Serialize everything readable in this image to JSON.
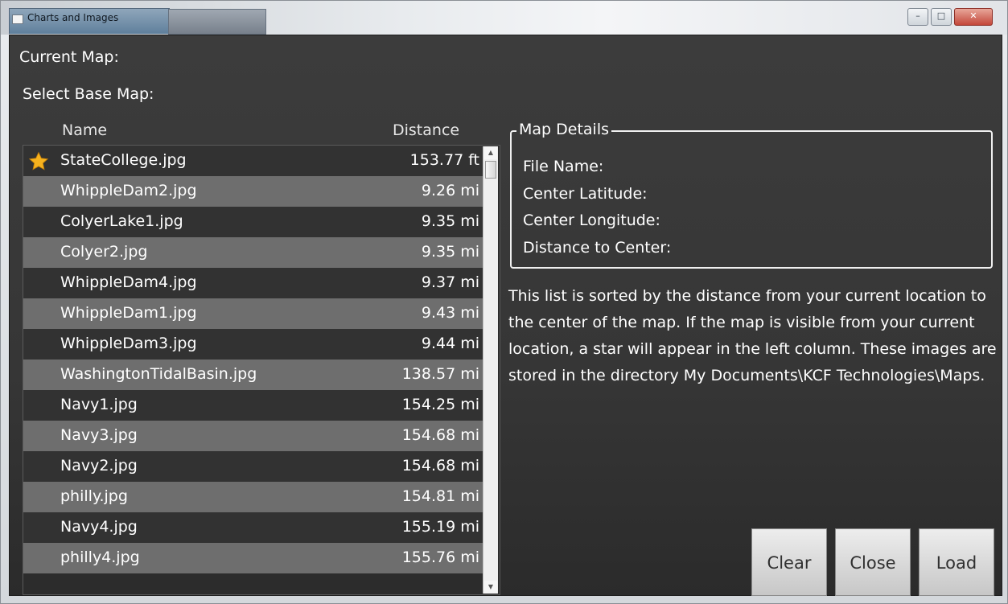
{
  "window": {
    "title": "Charts and Images"
  },
  "labels": {
    "current_map": "Current Map:",
    "select_base_map": "Select Base Map:"
  },
  "list": {
    "headers": {
      "name": "Name",
      "distance": "Distance"
    },
    "rows": [
      {
        "name": "StateCollege.jpg",
        "distance": "153.77 ft",
        "visible": true
      },
      {
        "name": "WhippleDam2.jpg",
        "distance": "9.26 mi"
      },
      {
        "name": "ColyerLake1.jpg",
        "distance": "9.35 mi"
      },
      {
        "name": "Colyer2.jpg",
        "distance": "9.35 mi"
      },
      {
        "name": "WhippleDam4.jpg",
        "distance": "9.37 mi"
      },
      {
        "name": "WhippleDam1.jpg",
        "distance": "9.43 mi"
      },
      {
        "name": "WhippleDam3.jpg",
        "distance": "9.44 mi"
      },
      {
        "name": "WashingtonTidalBasin.jpg",
        "distance": "138.57 mi"
      },
      {
        "name": "Navy1.jpg",
        "distance": "154.25 mi"
      },
      {
        "name": "Navy3.jpg",
        "distance": "154.68 mi"
      },
      {
        "name": "Navy2.jpg",
        "distance": "154.68 mi"
      },
      {
        "name": "philly.jpg",
        "distance": "154.81 mi"
      },
      {
        "name": "Navy4.jpg",
        "distance": "155.19 mi"
      },
      {
        "name": "philly4.jpg",
        "distance": "155.76 mi"
      }
    ],
    "visible_icon": "star-icon"
  },
  "details": {
    "legend": "Map Details",
    "file_name": "File Name:",
    "center_latitude": "Center Latitude:",
    "center_longitude": "Center Longitude:",
    "distance_to_center": "Distance to Center:"
  },
  "info_text": "This list is sorted by the distance from your current location to the center of the map.  If the map is visible from your current location, a star will appear in the left column.  These images are stored in the directory My Documents\\KCF Technologies\\Maps.",
  "buttons": {
    "clear": "Clear",
    "close": "Close",
    "load": "Load"
  },
  "colors": {
    "row_dark": "#323232",
    "row_light": "#6e6e6e",
    "star": "#f6b21e"
  }
}
